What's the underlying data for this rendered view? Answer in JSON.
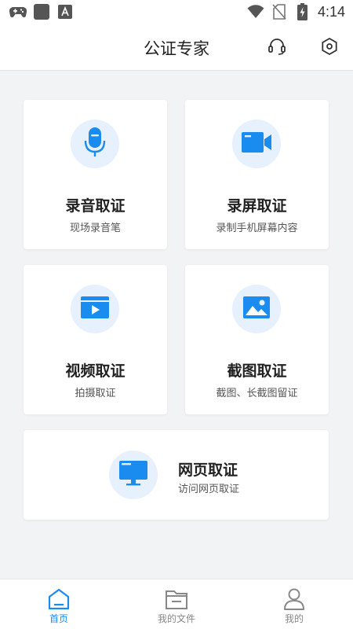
{
  "status_bar": {
    "time": "4:14",
    "left_icons": [
      "gamepad-icon",
      "square-app-icon",
      "text-app-icon"
    ],
    "right_icons": [
      "wifi-icon",
      "no-sim-icon",
      "battery-charging-icon"
    ]
  },
  "header": {
    "title": "公证专家",
    "headset_icon": "headset-icon",
    "settings_icon": "settings-hexagon-icon"
  },
  "cards": [
    {
      "id": "audio",
      "title": "录音取证",
      "subtitle": "现场录音笔",
      "icon": "microphone-icon"
    },
    {
      "id": "screen-record",
      "title": "录屏取证",
      "subtitle": "录制手机屏幕内容",
      "icon": "video-camera-icon"
    },
    {
      "id": "video",
      "title": "视频取证",
      "subtitle": "拍摄取证",
      "icon": "video-player-icon"
    },
    {
      "id": "screenshot",
      "title": "截图取证",
      "subtitle": "截图、长截图留证",
      "icon": "image-icon"
    },
    {
      "id": "webpage",
      "title": "网页取证",
      "subtitle": "访问网页取证",
      "icon": "monitor-icon"
    }
  ],
  "bottom_nav": {
    "items": [
      {
        "label": "首页",
        "icon": "home-icon",
        "active": true
      },
      {
        "label": "我的文件",
        "icon": "folder-icon",
        "active": false
      },
      {
        "label": "我的",
        "icon": "user-icon",
        "active": false
      }
    ]
  },
  "colors": {
    "accent": "#1a8cf0",
    "icon_bg": "#e6f1fd",
    "page_bg": "#f2f3f5"
  }
}
